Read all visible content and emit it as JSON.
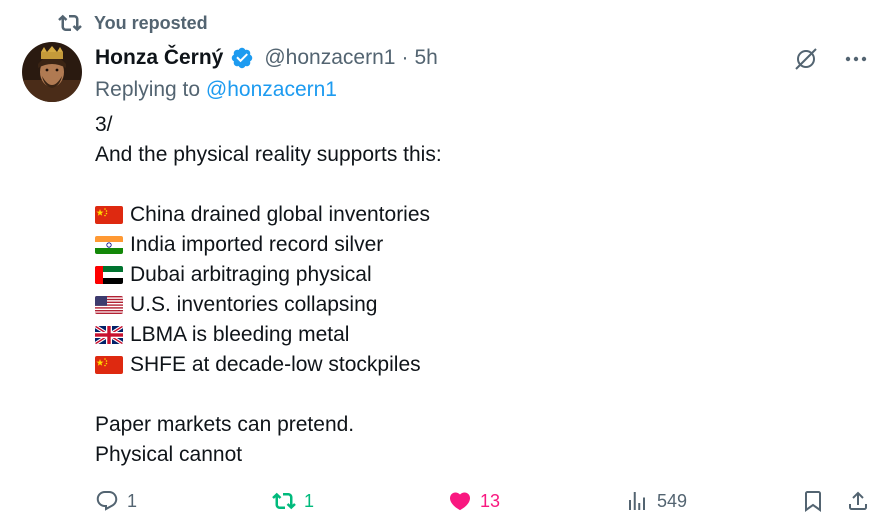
{
  "repost": {
    "label": "You reposted",
    "icon": "repost-icon"
  },
  "author": {
    "name": "Honza Černý",
    "handle": "@honzacern1",
    "separator": "·",
    "time": "5h",
    "verified": true
  },
  "reply_to": {
    "prefix": "Replying to",
    "handle": "@honzacern1"
  },
  "tweet": {
    "line1": "3/",
    "line2": "And the physical reality supports this:",
    "items": [
      {
        "flag": "china-flag",
        "text": "China drained global inventories"
      },
      {
        "flag": "india-flag",
        "text": "India imported record silver"
      },
      {
        "flag": "uae-flag",
        "text": "Dubai arbitraging physical"
      },
      {
        "flag": "usa-flag",
        "text": "U.S. inventories collapsing"
      },
      {
        "flag": "uk-flag",
        "text": "LBMA is bleeding metal"
      },
      {
        "flag": "china-flag",
        "text": "SHFE at decade-low stockpiles"
      }
    ],
    "line3": "Paper markets can pretend.",
    "line4": "Physical cannot"
  },
  "actions": {
    "replies": "1",
    "reposts": "1",
    "likes": "13",
    "views": "549"
  },
  "colors": {
    "text": "#0f1419",
    "muted": "#536471",
    "link": "#1d9bf0",
    "repost_active": "#00ba7c",
    "like_active": "#f91880"
  }
}
